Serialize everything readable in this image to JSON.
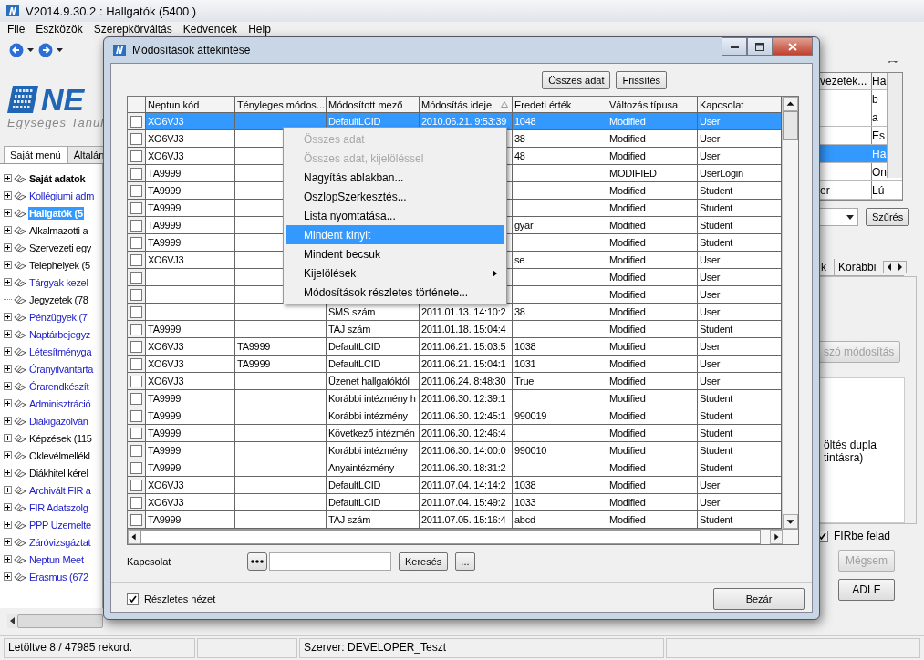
{
  "window": {
    "title": "V2014.9.30.2 : Hallgatók (5400  )"
  },
  "menu": [
    "File",
    "Eszközök",
    "Szerepkörváltás",
    "Kedvencek",
    "Help"
  ],
  "logo": {
    "name": "NE",
    "subtitle": "Egységes Tanul"
  },
  "left_tabs": [
    {
      "label": "Saját menü",
      "selected": true
    },
    {
      "label": "Általán",
      "selected": false
    }
  ],
  "tree": [
    {
      "label": "Saját adatok",
      "kind": "plain",
      "bold": true,
      "selected": false,
      "expandable": true
    },
    {
      "label": "Kollégiumi adm",
      "kind": "link",
      "bold": false,
      "selected": false,
      "expandable": true
    },
    {
      "label": "Hallgatók (5",
      "kind": "link",
      "bold": true,
      "selected": true,
      "expandable": true
    },
    {
      "label": "Alkalmazotti a",
      "kind": "plain",
      "bold": false,
      "selected": false,
      "expandable": true
    },
    {
      "label": "Szervezeti egy",
      "kind": "plain",
      "bold": false,
      "selected": false,
      "expandable": true
    },
    {
      "label": "Telephelyek (5",
      "kind": "plain",
      "bold": false,
      "selected": false,
      "expandable": true
    },
    {
      "label": "Tárgyak kezel",
      "kind": "link",
      "bold": false,
      "selected": false,
      "expandable": true
    },
    {
      "label": "Jegyzetek (78",
      "kind": "plain",
      "bold": false,
      "selected": false,
      "expandable": false
    },
    {
      "label": "Pénzügyek (7",
      "kind": "link",
      "bold": false,
      "selected": false,
      "expandable": true
    },
    {
      "label": "Naptárbejegyz",
      "kind": "link",
      "bold": false,
      "selected": false,
      "expandable": true
    },
    {
      "label": "Létesítményga",
      "kind": "link",
      "bold": false,
      "selected": false,
      "expandable": true
    },
    {
      "label": "Óranyilvántarta",
      "kind": "link",
      "bold": false,
      "selected": false,
      "expandable": true
    },
    {
      "label": "Órarendkészít",
      "kind": "link",
      "bold": false,
      "selected": false,
      "expandable": true
    },
    {
      "label": "Adminisztráció",
      "kind": "link",
      "bold": false,
      "selected": false,
      "expandable": true
    },
    {
      "label": "Diákigazolván",
      "kind": "link",
      "bold": false,
      "selected": false,
      "expandable": true
    },
    {
      "label": "Képzések (115",
      "kind": "plain",
      "bold": false,
      "selected": false,
      "expandable": true
    },
    {
      "label": "Oklevélmellékl",
      "kind": "plain",
      "bold": false,
      "selected": false,
      "expandable": true
    },
    {
      "label": "Diákhitel kérel",
      "kind": "plain",
      "bold": false,
      "selected": false,
      "expandable": true
    },
    {
      "label": "Archivált FIR a",
      "kind": "link",
      "bold": false,
      "selected": false,
      "expandable": true
    },
    {
      "label": "FIR Adatszolg",
      "kind": "link",
      "bold": false,
      "selected": false,
      "expandable": true
    },
    {
      "label": "PPP Üzemelte",
      "kind": "link",
      "bold": false,
      "selected": false,
      "expandable": true
    },
    {
      "label": "Záróvizsgáztat",
      "kind": "link",
      "bold": false,
      "selected": false,
      "expandable": true
    },
    {
      "label": "Neptun Meet",
      "kind": "link",
      "bold": false,
      "selected": false,
      "expandable": true
    },
    {
      "label": "Erasmus (672",
      "kind": "link",
      "bold": false,
      "selected": false,
      "expandable": true
    }
  ],
  "right_panel": {
    "grid": {
      "columns": [
        "vezeték...",
        "Ha"
      ],
      "rows": [
        {
          "column_2": "b",
          "selected": false
        },
        {
          "column_2": "a",
          "selected": false
        },
        {
          "column_2": "Es",
          "selected": false
        },
        {
          "column_2": "Ha",
          "selected": true
        },
        {
          "column_2": "On",
          "selected": false
        },
        {
          "column_1": "er",
          "column_2": "Lú",
          "selected": false
        }
      ]
    },
    "filter_button": "Szűrés",
    "tabs": [
      "k",
      "Korábbi"
    ],
    "action_button": {
      "label": "szó módosítás",
      "disabled": true
    },
    "note_lines": [
      "öltés dupla",
      "tintásra)"
    ],
    "fir_checkbox": {
      "label": "FIRbe felad",
      "checked": true
    },
    "cancel_button": {
      "label": "Mégsem",
      "disabled": true
    },
    "adle_button": {
      "label": "ADLE",
      "disabled": false
    }
  },
  "status_bar": [
    "Letöltve 8 / 47985 rekord.",
    "Szerver: DEVELOPER_Teszt"
  ],
  "dialog": {
    "title": "Módosítások áttekintése",
    "buttons": [
      "Összes adat",
      "Frissítés"
    ],
    "table": {
      "columns": [
        {
          "label": "Neptun kód",
          "sorted": false
        },
        {
          "label": "Tényleges módos...",
          "sorted": false
        },
        {
          "label": "Módosított mező",
          "sorted": false
        },
        {
          "label": "Módosítás ideje",
          "sorted": true
        },
        {
          "label": "Eredeti érték",
          "sorted": false
        },
        {
          "label": "Változás típusa",
          "sorted": false
        },
        {
          "label": "Kapcsolat",
          "sorted": false
        }
      ],
      "rows": [
        {
          "selected": true,
          "checked": false,
          "neptun_kod": "XO6VJ3",
          "modositott_mezo": "DefaultLCID",
          "modositas_ideje": "2010.06.21. 9:53:39",
          "eredeti_ertek": "1048",
          "valtozas_tipusa": "Modified",
          "kapcsolat": "User"
        },
        {
          "selected": false,
          "checked": false,
          "neptun_kod": "XO6VJ3",
          "eredeti_ertek": "38",
          "valtozas_tipusa": "Modified",
          "kapcsolat": "User"
        },
        {
          "selected": false,
          "checked": false,
          "neptun_kod": "XO6VJ3",
          "eredeti_ertek": "48",
          "valtozas_tipusa": "Modified",
          "kapcsolat": "User"
        },
        {
          "selected": false,
          "checked": false,
          "neptun_kod": "TA9999",
          "valtozas_tipusa": "MODIFIED",
          "kapcsolat": "UserLogin"
        },
        {
          "selected": false,
          "checked": false,
          "neptun_kod": "TA9999",
          "valtozas_tipusa": "Modified",
          "kapcsolat": "Student"
        },
        {
          "selected": false,
          "checked": false,
          "neptun_kod": "TA9999",
          "valtozas_tipusa": "Modified",
          "kapcsolat": "Student"
        },
        {
          "selected": false,
          "checked": false,
          "neptun_kod": "TA9999",
          "eredeti_ertek": "gyar",
          "valtozas_tipusa": "Modified",
          "kapcsolat": "Student"
        },
        {
          "selected": false,
          "checked": false,
          "neptun_kod": "TA9999",
          "valtozas_tipusa": "Modified",
          "kapcsolat": "Student"
        },
        {
          "selected": false,
          "checked": false,
          "neptun_kod": "XO6VJ3",
          "eredeti_ertek": "se",
          "valtozas_tipusa": "Modified",
          "kapcsolat": "User"
        },
        {
          "selected": false,
          "checked": false,
          "valtozas_tipusa": "Modified",
          "kapcsolat": "User"
        },
        {
          "selected": false,
          "checked": false,
          "valtozas_tipusa": "Modified",
          "kapcsolat": "User"
        },
        {
          "selected": false,
          "checked": false,
          "modositott_mezo": "SMS szám",
          "modositas_ideje": "2011.01.13. 14:10:2",
          "eredeti_ertek": "38",
          "valtozas_tipusa": "Modified",
          "kapcsolat": "User"
        },
        {
          "selected": false,
          "checked": false,
          "neptun_kod": "TA9999",
          "modositott_mezo": "TAJ szám",
          "modositas_ideje": "2011.01.18. 15:04:4",
          "valtozas_tipusa": "Modified",
          "kapcsolat": "Student"
        },
        {
          "selected": false,
          "checked": false,
          "neptun_kod": "XO6VJ3",
          "tenyleges_modosito": "TA9999",
          "modositott_mezo": "DefaultLCID",
          "modositas_ideje": "2011.06.21. 15:03:5",
          "eredeti_ertek": "1038",
          "valtozas_tipusa": "Modified",
          "kapcsolat": "User"
        },
        {
          "selected": false,
          "checked": false,
          "neptun_kod": "XO6VJ3",
          "tenyleges_modosito": "TA9999",
          "modositott_mezo": "DefaultLCID",
          "modositas_ideje": "2011.06.21. 15:04:1",
          "eredeti_ertek": "1031",
          "valtozas_tipusa": "Modified",
          "kapcsolat": "User"
        },
        {
          "selected": false,
          "checked": false,
          "neptun_kod": "XO6VJ3",
          "modositott_mezo": "Üzenet hallgatóktól",
          "modositas_ideje": "2011.06.24. 8:48:30",
          "eredeti_ertek": "True",
          "valtozas_tipusa": "Modified",
          "kapcsolat": "User"
        },
        {
          "selected": false,
          "checked": false,
          "neptun_kod": "TA9999",
          "modositott_mezo": "Korábbi intézmény h",
          "modositas_ideje": "2011.06.30. 12:39:1",
          "valtozas_tipusa": "Modified",
          "kapcsolat": "Student"
        },
        {
          "selected": false,
          "checked": false,
          "neptun_kod": "TA9999",
          "modositott_mezo": "Korábbi intézmény",
          "modositas_ideje": "2011.06.30. 12:45:1",
          "eredeti_ertek": "990019",
          "valtozas_tipusa": "Modified",
          "kapcsolat": "Student"
        },
        {
          "selected": false,
          "checked": false,
          "neptun_kod": "TA9999",
          "modositott_mezo": "Következő intézmén",
          "modositas_ideje": "2011.06.30. 12:46:4",
          "valtozas_tipusa": "Modified",
          "kapcsolat": "Student"
        },
        {
          "selected": false,
          "checked": false,
          "neptun_kod": "TA9999",
          "modositott_mezo": "Korábbi intézmény",
          "modositas_ideje": "2011.06.30. 14:00:0",
          "eredeti_ertek": "990010",
          "valtozas_tipusa": "Modified",
          "kapcsolat": "Student"
        },
        {
          "selected": false,
          "checked": false,
          "neptun_kod": "TA9999",
          "modositott_mezo": "Anyaintézmény",
          "modositas_ideje": "2011.06.30. 18:31:2",
          "valtozas_tipusa": "Modified",
          "kapcsolat": "Student"
        },
        {
          "selected": false,
          "checked": false,
          "neptun_kod": "XO6VJ3",
          "modositott_mezo": "DefaultLCID",
          "modositas_ideje": "2011.07.04. 14:14:2",
          "eredeti_ertek": "1038",
          "valtozas_tipusa": "Modified",
          "kapcsolat": "User"
        },
        {
          "selected": false,
          "checked": false,
          "neptun_kod": "XO6VJ3",
          "modositott_mezo": "DefaultLCID",
          "modositas_ideje": "2011.07.04. 15:49:2",
          "eredeti_ertek": "1033",
          "valtozas_tipusa": "Modified",
          "kapcsolat": "User"
        },
        {
          "selected": false,
          "checked": false,
          "neptun_kod": "TA9999",
          "modositott_mezo": "TAJ szám",
          "modositas_ideje": "2011.07.05. 15:16:4",
          "eredeti_ertek": "abcd",
          "valtozas_tipusa": "Modified",
          "kapcsolat": "Student"
        }
      ]
    },
    "context_menu": [
      {
        "label": "Összes adat",
        "disabled": true,
        "selected": false,
        "submenu": false
      },
      {
        "label": "Összes adat, kijelöléssel",
        "disabled": true,
        "selected": false,
        "submenu": false
      },
      {
        "label": "Nagyítás ablakban...",
        "disabled": false,
        "selected": false,
        "submenu": false
      },
      {
        "label": "OszlopSzerkesztés...",
        "disabled": false,
        "selected": false,
        "submenu": false
      },
      {
        "label": "Lista nyomtatása...",
        "disabled": false,
        "selected": false,
        "submenu": false
      },
      {
        "label": "Mindent kinyit",
        "disabled": false,
        "selected": true,
        "submenu": false
      },
      {
        "label": "Mindent becsuk",
        "disabled": false,
        "selected": false,
        "submenu": false
      },
      {
        "label": "Kijelölések",
        "disabled": false,
        "selected": false,
        "submenu": true
      },
      {
        "label": "Módosítások részletes története...",
        "disabled": false,
        "selected": false,
        "submenu": false
      }
    ],
    "search": {
      "label": "Kapcsolat",
      "button": "Keresés",
      "more": "..."
    },
    "detail_checkbox": {
      "label": "Részletes nézet",
      "checked": true
    },
    "close_button": "Bezár"
  }
}
